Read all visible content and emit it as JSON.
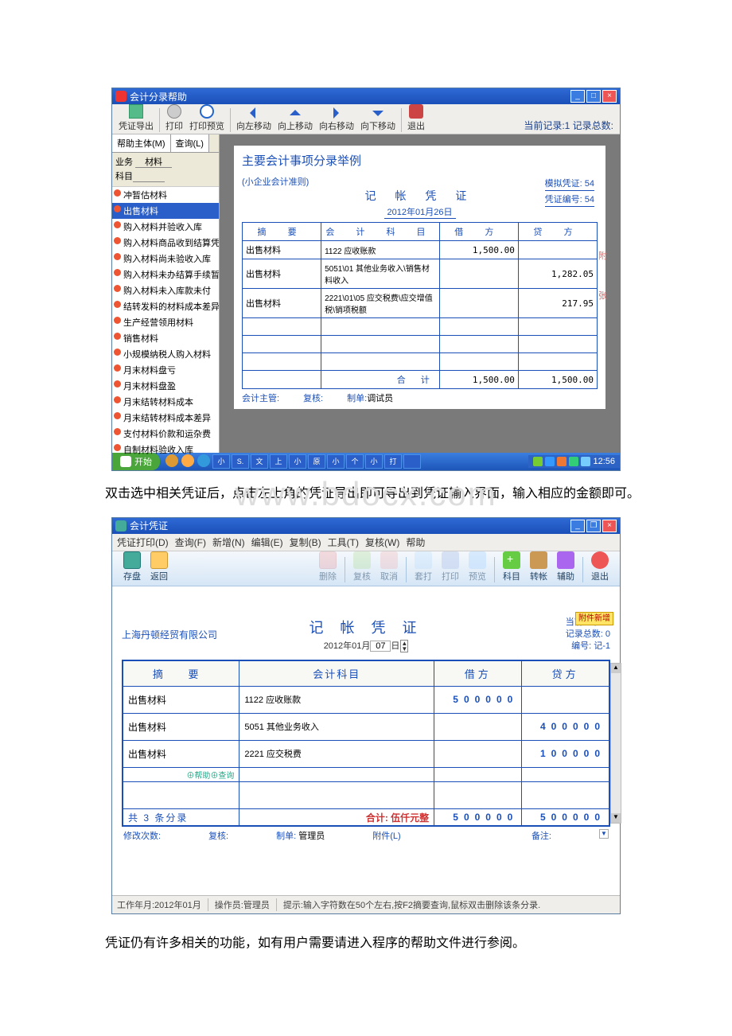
{
  "win1": {
    "title": "会计分录帮助",
    "toolbar": {
      "export": "凭证导出",
      "print": "打印",
      "preview": "打印预览",
      "left": "向左移动",
      "up": "向上移动",
      "right": "向右移动",
      "down": "向下移动",
      "exit": "退出"
    },
    "recinfo": "当前记录:1 记录总数:",
    "sb_tabs": {
      "main": "帮助主体(M)",
      "query": "查询(L)"
    },
    "sb_search": {
      "biz_lab": "业务",
      "biz_val": "材料",
      "subj_lab": "科目"
    },
    "sb_items": [
      "冲暂估材料",
      "出售材料",
      "购入材料并验收入库",
      "购入材料商品收到结算凭证",
      "购入材料尚未验收入库",
      "购入材料未办结算手续暂估",
      "购入材料未入库款未付",
      "结转发料的材料成本差异",
      "生产经营领用材料",
      "销售材料",
      "小规模纳税人购入材料",
      "月末材料盘亏",
      "月末材料盘盈",
      "月末结转材料成本",
      "月末结转材料成本差异",
      "支付材料价款和运杂费",
      "自制材料验收入库"
    ],
    "sb_sel_index": 1,
    "paper": {
      "title": "主要会计事项分录举例",
      "rule": "(小企业会计准则)",
      "bigtitle": "记 帐 凭 证",
      "date": "2012年01月26日",
      "sim": "模拟凭证: 54",
      "vno": "凭证编号: 54",
      "headers": {
        "summary": "摘 要",
        "subject": "会 计 科 目",
        "debit": "借 方",
        "credit": "贷 方"
      },
      "rows": [
        {
          "s": "出售材料",
          "k": "1122 应收账款",
          "d": "1,500.00",
          "c": ""
        },
        {
          "s": "出售材料",
          "k": "5051\\01 其他业务收入\\销售材料收入",
          "d": "",
          "c": "1,282.05"
        },
        {
          "s": "出售材料",
          "k": "2221\\01\\05 应交税费\\应交增值税\\销项税额",
          "d": "",
          "c": "217.95"
        }
      ],
      "blank_rows": 3,
      "total_lab": "合 计",
      "total_d": "1,500.00",
      "total_c": "1,500.00",
      "side1": "附",
      "side2": "张",
      "foot": {
        "mgr": "会计主管:",
        "chk": "复核:",
        "maker": "制单:",
        "maker_v": "调试员"
      }
    },
    "taskbar": {
      "start": "开始",
      "items": [
        "小",
        "S.",
        "文",
        "上",
        "小",
        "原",
        "小",
        "个",
        "小",
        "打",
        ""
      ],
      "clock": "12:56"
    }
  },
  "desc1": "双击选中相关凭证后，点击左上角的凭证导出即可导出到凭证输入界面，输入相应的金额即可。",
  "watermark": "www.bdocx.com",
  "win2": {
    "title": "会计凭证",
    "menu": [
      "凭证打印(D)",
      "查询(F)",
      "新增(N)",
      "编辑(E)",
      "复制(B)",
      "工具(T)",
      "复核(W)",
      "帮助"
    ],
    "toolbar": {
      "save": "存盘",
      "back": "返回",
      "del": "删除",
      "restore": "复核",
      "cancel": "取消",
      "reprint": "套打",
      "print": "打印",
      "preview": "预览",
      "subject": "科目",
      "trans": "转帐",
      "aux": "辅助",
      "exit": "退出"
    },
    "company": "上海丹顿经贸有限公司",
    "bigtitle": "记 帐 凭 证",
    "date_pre": "2012年01月",
    "date_day": "07",
    "date_suf": "日",
    "rinfo": {
      "cur": "当前记录: 1",
      "total": "记录总数: 0",
      "no": "编号: 记-1"
    },
    "attach": "附件新增",
    "headers": {
      "summary": "摘 要",
      "subject": "会计科目",
      "debit": "借方",
      "credit": "贷方"
    },
    "rows": [
      {
        "s": "出售材料",
        "k": "1122 应收账款",
        "d": "500000",
        "c": ""
      },
      {
        "s": "出售材料",
        "k": "5051 其他业务收入",
        "d": "",
        "c": "400000"
      },
      {
        "s": "出售材料",
        "k": "2221 应交税费",
        "d": "",
        "c": "100000"
      }
    ],
    "helper": "⊕帮助⊕查询",
    "count": "共 3 条分录",
    "totlab": "合计: 伍仟元整",
    "tot_d": "500000",
    "tot_c": "500000",
    "foot": {
      "mod": "修改次数:",
      "chk": "复核:",
      "maker": "制单:",
      "maker_v": "管理员",
      "att": "附件(L)",
      "memo": "备注:"
    },
    "status": {
      "period": "工作年月:2012年01月",
      "op": "操作员:管理员",
      "tip": "提示:输入字符数在50个左右,按F2摘要查询,鼠标双击删除该条分录."
    }
  },
  "desc2": "凭证仍有许多相关的功能，如有用户需要请进入程序的帮助文件进行参阅。"
}
